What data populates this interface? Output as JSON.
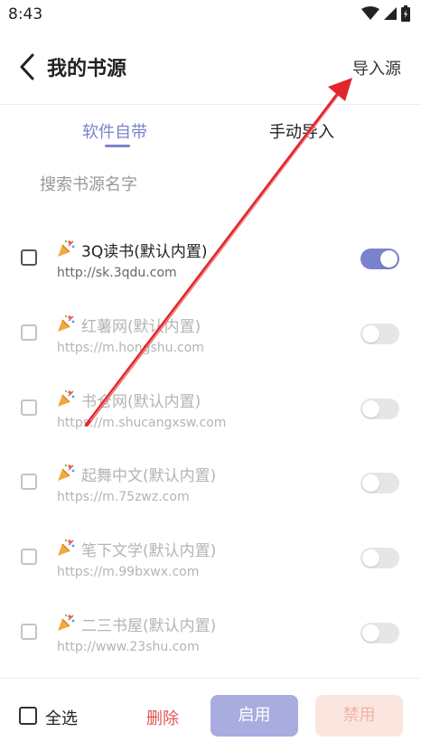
{
  "status_bar": {
    "time": "8:43"
  },
  "header": {
    "title": "我的书源",
    "import_label": "导入源"
  },
  "tabs": [
    {
      "label": "软件自带",
      "active": true
    },
    {
      "label": "手动导入",
      "active": false
    }
  ],
  "search": {
    "placeholder": "搜索书源名字",
    "value": ""
  },
  "sources": [
    {
      "title": "3Q读书(默认内置)",
      "url": "http://sk.3qdu.com",
      "enabled": true
    },
    {
      "title": "红薯网(默认内置)",
      "url": "https://m.hongshu.com",
      "enabled": false
    },
    {
      "title": "书仓网(默认内置)",
      "url": "https://m.shucangxsw.com",
      "enabled": false
    },
    {
      "title": "起舞中文(默认内置)",
      "url": "https://m.75zwz.com",
      "enabled": false
    },
    {
      "title": "笔下文学(默认内置)",
      "url": "https://m.99bxwx.com",
      "enabled": false
    },
    {
      "title": "二三书屋(默认内置)",
      "url": "http://www.23shu.com",
      "enabled": false
    }
  ],
  "bottom_bar": {
    "select_all_label": "全选",
    "delete_label": "删除",
    "enable_label": "启用",
    "disable_label": "禁用"
  },
  "colors": {
    "accent": "#7b82cc",
    "delete": "#e0554f",
    "enable_bg": "#a9acdf",
    "disable_bg": "#fbe6df",
    "annotation_arrow": "#e3262b"
  },
  "icons": {
    "status": [
      "wifi-icon",
      "signal-icon",
      "battery-icon"
    ],
    "back": "chevron-left-icon",
    "item_emoji": "party-popper-icon"
  }
}
